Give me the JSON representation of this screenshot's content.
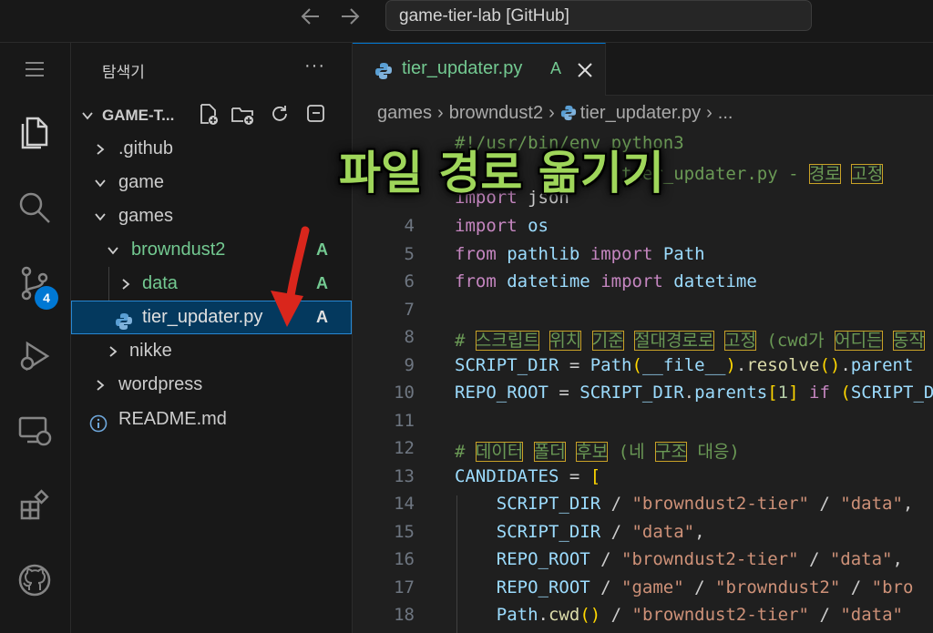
{
  "window": {
    "search_text": "game-tier-lab [GitHub]"
  },
  "activity_bar": {
    "source_control_badge": "4"
  },
  "explorer": {
    "title": "탐색기",
    "more": "···",
    "root_label": "GAME-T...",
    "tree": [
      {
        "label": ".github",
        "status": ""
      },
      {
        "label": "game",
        "status": ""
      },
      {
        "label": "games",
        "status": ""
      },
      {
        "label": "browndust2",
        "status": "A"
      },
      {
        "label": "data",
        "status": "A"
      },
      {
        "label": "tier_updater.py",
        "status": "A"
      },
      {
        "label": "nikke",
        "status": ""
      },
      {
        "label": "wordpress",
        "status": ""
      },
      {
        "label": "README.md",
        "status": ""
      }
    ]
  },
  "editor": {
    "tab": {
      "label": "tier_updater.py",
      "status": "A"
    },
    "breadcrumb": [
      "games",
      "browndust2",
      "tier_updater.py",
      "..."
    ],
    "line_numbers": [
      "4",
      "5",
      "6",
      "7",
      "8",
      "9",
      "10",
      "11",
      "12",
      "13",
      "14",
      "15",
      "16",
      "17",
      "18"
    ],
    "partial_top": {
      "line1": "#!/usr/bin/env python3",
      "line2_prefix": "#",
      "line2_file": "tier_updater.py - ",
      "line2_tokens": [
        "경로",
        "고정"
      ],
      "line3": "import json"
    },
    "comment_line8_tokens": [
      "스크립트",
      "위치",
      "기준",
      "절대경로로",
      "고정",
      "(cwd가",
      "어디든",
      "동작"
    ],
    "comment_line12_tokens": [
      "데이터",
      "폴더",
      "후보",
      "(네",
      "구조",
      "대응)"
    ]
  },
  "overlay_caption": "파일 경로 옮기기",
  "colors": {
    "git_added": "#73c991",
    "selection": "#04395e",
    "accent": "#0078d4",
    "caption": "#9fd65a",
    "arrow": "#d9261c"
  }
}
